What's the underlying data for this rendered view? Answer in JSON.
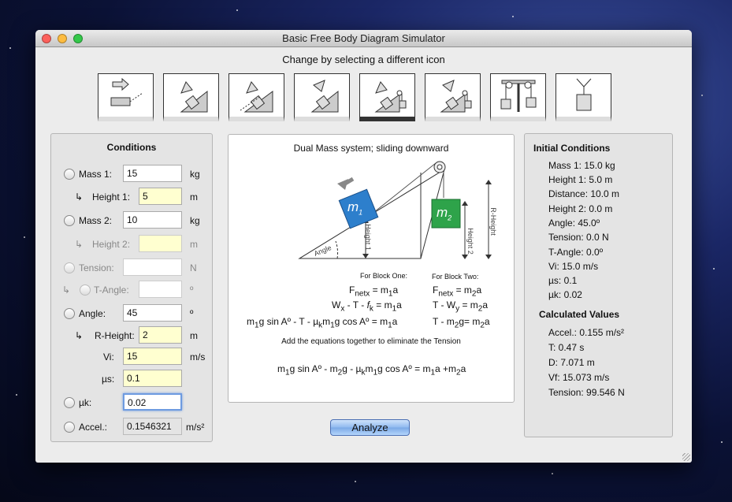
{
  "window": {
    "title": "Basic Free Body Diagram Simulator",
    "subtitle": "Change by selecting a different icon"
  },
  "icons": [
    {
      "name": "horizontal-push-icon"
    },
    {
      "name": "incline-down-icon"
    },
    {
      "name": "incline-down-distance-icon"
    },
    {
      "name": "incline-up-icon"
    },
    {
      "name": "incline-dual-mass-down-icon",
      "selected": true
    },
    {
      "name": "incline-dual-mass-up-icon"
    },
    {
      "name": "atwood-machine-icon"
    },
    {
      "name": "hanging-mass-icon"
    }
  ],
  "conditions": {
    "title": "Conditions",
    "mass1": {
      "label": "Mass 1:",
      "value": "15",
      "unit": "kg"
    },
    "height1": {
      "label": "Height 1:",
      "value": "5",
      "unit": "m"
    },
    "mass2": {
      "label": "Mass 2:",
      "value": "10",
      "unit": "kg"
    },
    "height2": {
      "label": "Height 2:",
      "value": "",
      "unit": "m"
    },
    "tension": {
      "label": "Tension:",
      "value": "",
      "unit": "N"
    },
    "tangle": {
      "label": "T-Angle:",
      "value": "",
      "unit": "º"
    },
    "angle": {
      "label": "Angle:",
      "value": "45",
      "unit": "º"
    },
    "rheight": {
      "label": "R-Height:",
      "value": "2",
      "unit": "m"
    },
    "vi": {
      "label": "Vi:",
      "value": "15",
      "unit": "m/s"
    },
    "us": {
      "label": "µs:",
      "value": "0.1"
    },
    "uk": {
      "label": "µk:",
      "value": "0.02"
    },
    "accel": {
      "label": "Accel.:",
      "value": "0.1546321",
      "unit": "m/s²"
    }
  },
  "diagram": {
    "title": "Dual Mass system; sliding downward",
    "m1": "m",
    "m1sub": "1",
    "m2": "m",
    "m2sub": "2",
    "angle_label": "Angle",
    "height1_label": "Height 1",
    "height2_label": "Height 2",
    "rheight_label": "R-Height",
    "block_one": "For Block One:",
    "block_two": "For Block Two:",
    "eq1a": "F",
    "eq1a_sub": "netx",
    "eq1a_rhs": " = m",
    "eq1a_rsub": "1",
    "eq1a_end": "a",
    "eq2a": "W",
    "eq2a_sub": "x",
    "eq2a_mid": " - T - ",
    "eq2a_f": "f",
    "eq2a_fsub": "k",
    "eq2a_rhs": "  = m",
    "eq2a_rsub": "1",
    "eq2a_end": "a",
    "eq3a": "m",
    "eq3a_s1": "1",
    "eq3a_t1": "g sin Aº - T - µ",
    "eq3a_s2": "k",
    "eq3a_t2": "m",
    "eq3a_s3": "1",
    "eq3a_t3": "g cos Aº  = m",
    "eq3a_s4": "1",
    "eq3a_end": "a",
    "eq1b": "F",
    "eq1b_sub": "netx",
    "eq1b_rhs": " = m",
    "eq1b_rsub": "2",
    "eq1b_end": "a",
    "eq2b": "T - W",
    "eq2b_sub": "y",
    "eq2b_rhs": " = m",
    "eq2b_rsub": "2",
    "eq2b_end": "a",
    "eq3b": "T - m",
    "eq3b_sub": "2",
    "eq3b_mid": "g= m",
    "eq3b_rsub": "2",
    "eq3b_end": "a",
    "note": "Add the equations together to eliminate the Tension",
    "final_t1": "m",
    "final_s1": "1",
    "final_t2": "g sin Aº - m",
    "final_s2": "2",
    "final_t3": "g - µ",
    "final_s3": "k",
    "final_t4": "m",
    "final_s4": "1",
    "final_t5": "g cos Aº  = m",
    "final_s5": "1",
    "final_t6": "a +m",
    "final_s6": "2",
    "final_t7": "a"
  },
  "initial": {
    "title": "Initial Conditions",
    "items": [
      "Mass 1: 15.0 kg",
      "Height 1: 5.0 m",
      "Distance: 10.0 m",
      "Height 2: 0.0 m",
      "Angle: 45.0º",
      "Tension: 0.0 N",
      "T-Angle: 0.0º",
      "Vi: 15.0 m/s",
      "µs: 0.1",
      "µk: 0.02"
    ]
  },
  "calculated": {
    "title": "Calculated Values",
    "accel": "Accel.: 0.155 m/s²",
    "items": [
      "T: 0.47 s",
      "D: 7.071 m",
      "Vf: 15.073 m/s",
      "Tension: 99.546 N"
    ]
  },
  "analyze_label": "Analyze"
}
